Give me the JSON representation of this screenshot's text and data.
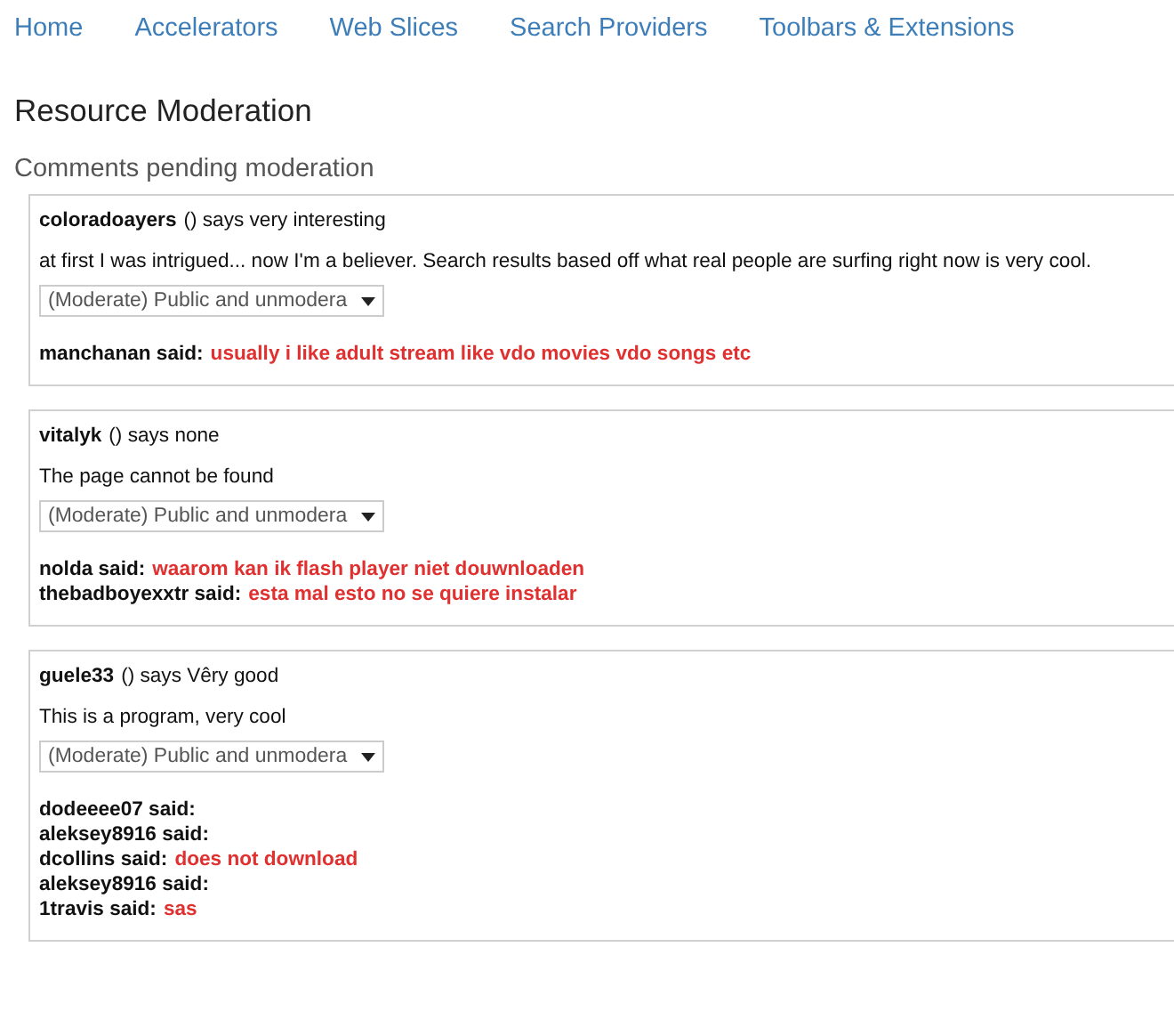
{
  "nav": [
    {
      "label": "Home"
    },
    {
      "label": "Accelerators"
    },
    {
      "label": "Web Slices"
    },
    {
      "label": "Search Providers"
    },
    {
      "label": "Toolbars & Extensions"
    }
  ],
  "title": "Resource Moderation",
  "subtitle": "Comments pending moderation",
  "items": [
    {
      "user": "coloradoayers",
      "says": "() says very interesting",
      "body": "at first I was intrigued... now I'm a believer. Search results based off what real people are surfing right now is very cool.",
      "status": "(Moderate) Public and unmodera",
      "comments": [
        {
          "author": "manchanan said:",
          "text": "usually i like adult stream like vdo movies vdo songs etc"
        }
      ]
    },
    {
      "user": "vitalyk",
      "says": "() says none",
      "body": "The page cannot be found",
      "status": "(Moderate) Public and unmodera",
      "comments": [
        {
          "author": "nolda said:",
          "text": "waarom kan ik flash player niet douwnloaden"
        },
        {
          "author": "thebadboyexxtr said:",
          "text": "esta mal esto no se quiere instalar"
        }
      ]
    },
    {
      "user": "guele33",
      "says": "() says Vêry good",
      "body": "This is a program, very cool",
      "status": "(Moderate) Public and unmodera",
      "comments": [
        {
          "author": "dodeeee07 said:"
        },
        {
          "author": "aleksey8916 said:"
        },
        {
          "author": "dcollins said:",
          "text": "does not download"
        },
        {
          "author": "aleksey8916 said:"
        },
        {
          "author": "1travis said:",
          "text": "sas"
        }
      ]
    }
  ]
}
